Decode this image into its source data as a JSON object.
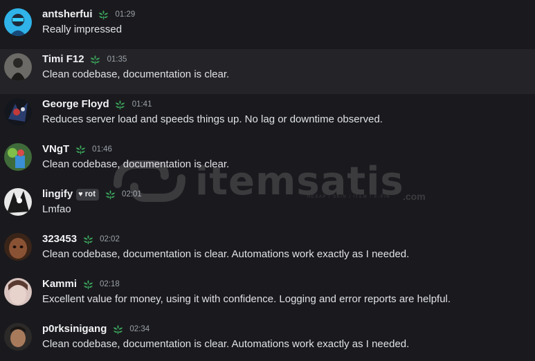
{
  "messages": [
    {
      "author": "antsherfui",
      "time": "01:29",
      "text": "Really impressed",
      "role": ""
    },
    {
      "author": "Timi F12",
      "time": "01:35",
      "text": "Clean codebase, documentation is clear.",
      "role": ""
    },
    {
      "author": "George Floyd",
      "time": "01:41",
      "text": "Reduces server load and speeds things up. No lag or downtime observed.",
      "role": ""
    },
    {
      "author": "VNgT",
      "time": "01:46",
      "text": "Clean codebase, documentation is clear.",
      "role": ""
    },
    {
      "author": "lingify",
      "time": "02:01",
      "text": "Lmfao",
      "role": "rot"
    },
    {
      "author": "323453",
      "time": "02:02",
      "text": "Clean codebase, documentation is clear. Automations work exactly as I needed.",
      "role": ""
    },
    {
      "author": "Kammi",
      "time": "02:18",
      "text": "Excellent value for money, using it with confidence. Logging and error reports are helpful.",
      "role": ""
    },
    {
      "author": "p0rksinigang",
      "time": "02:34",
      "text": "Clean codebase, documentation is clear. Automations work exactly as I needed.",
      "role": ""
    }
  ],
  "watermark": {
    "word": "itemsatis",
    "tagline": "HESAP / SKIN / ITEM / E-PIN",
    "suffix": ".com"
  },
  "colors": {
    "background": "#1a1a1e",
    "hover_row": "#242428",
    "badge": "#3ba55c",
    "name": "#f2f3f5",
    "timestamp": "#9aa0a8"
  },
  "icons": {
    "badge": "leaf-badge-icon",
    "role": "heart-icon"
  }
}
